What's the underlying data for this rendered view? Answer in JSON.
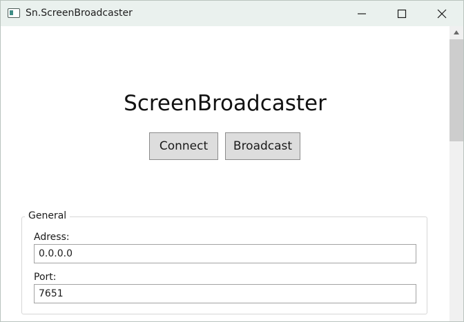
{
  "window": {
    "title": "Sn.ScreenBroadcaster",
    "icon": "app-window-icon",
    "controls": [
      "minimize-icon",
      "maximize-icon",
      "close-icon"
    ]
  },
  "main": {
    "heading": "ScreenBroadcaster",
    "connect_label": "Connect",
    "broadcast_label": "Broadcast"
  },
  "general": {
    "legend": "General",
    "address_label": "Adress:",
    "address_value": "0.0.0.0",
    "port_label": "Port:",
    "port_value": "7651"
  },
  "colors": {
    "titlebar": "#eaf1ee",
    "button_face": "#dddddd",
    "scroll_thumb": "#cdcdcd"
  }
}
